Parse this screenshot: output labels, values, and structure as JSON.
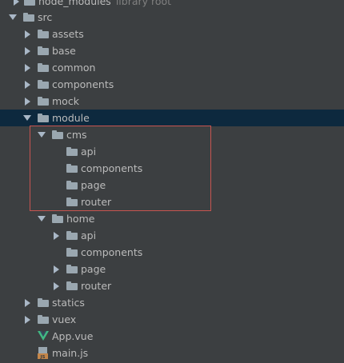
{
  "tree": {
    "top_node": {
      "label": "node_modules",
      "suffix": "library root"
    },
    "src": {
      "label": "src"
    },
    "src_children": [
      {
        "label": "assets"
      },
      {
        "label": "base"
      },
      {
        "label": "common"
      },
      {
        "label": "components"
      },
      {
        "label": "mock"
      }
    ],
    "module": {
      "label": "module"
    },
    "cms": {
      "label": "cms",
      "children": [
        {
          "label": "api"
        },
        {
          "label": "components"
        },
        {
          "label": "page"
        },
        {
          "label": "router"
        }
      ]
    },
    "home": {
      "label": "home",
      "children": [
        {
          "label": "api"
        },
        {
          "label": "components"
        },
        {
          "label": "page"
        },
        {
          "label": "router"
        }
      ]
    },
    "after_module": [
      {
        "label": "statics"
      },
      {
        "label": "vuex"
      }
    ],
    "files": [
      {
        "label": "App.vue",
        "icon": "vue-file-icon"
      },
      {
        "label": "main.js",
        "icon": "js-file-icon"
      }
    ]
  },
  "colors": {
    "background": "#3c3f41",
    "selection": "#0d293e",
    "folder": "#9aa7b0",
    "vue_green": "#41b883",
    "js_orange": "#c4864a",
    "highlight_border": "#c75450"
  }
}
